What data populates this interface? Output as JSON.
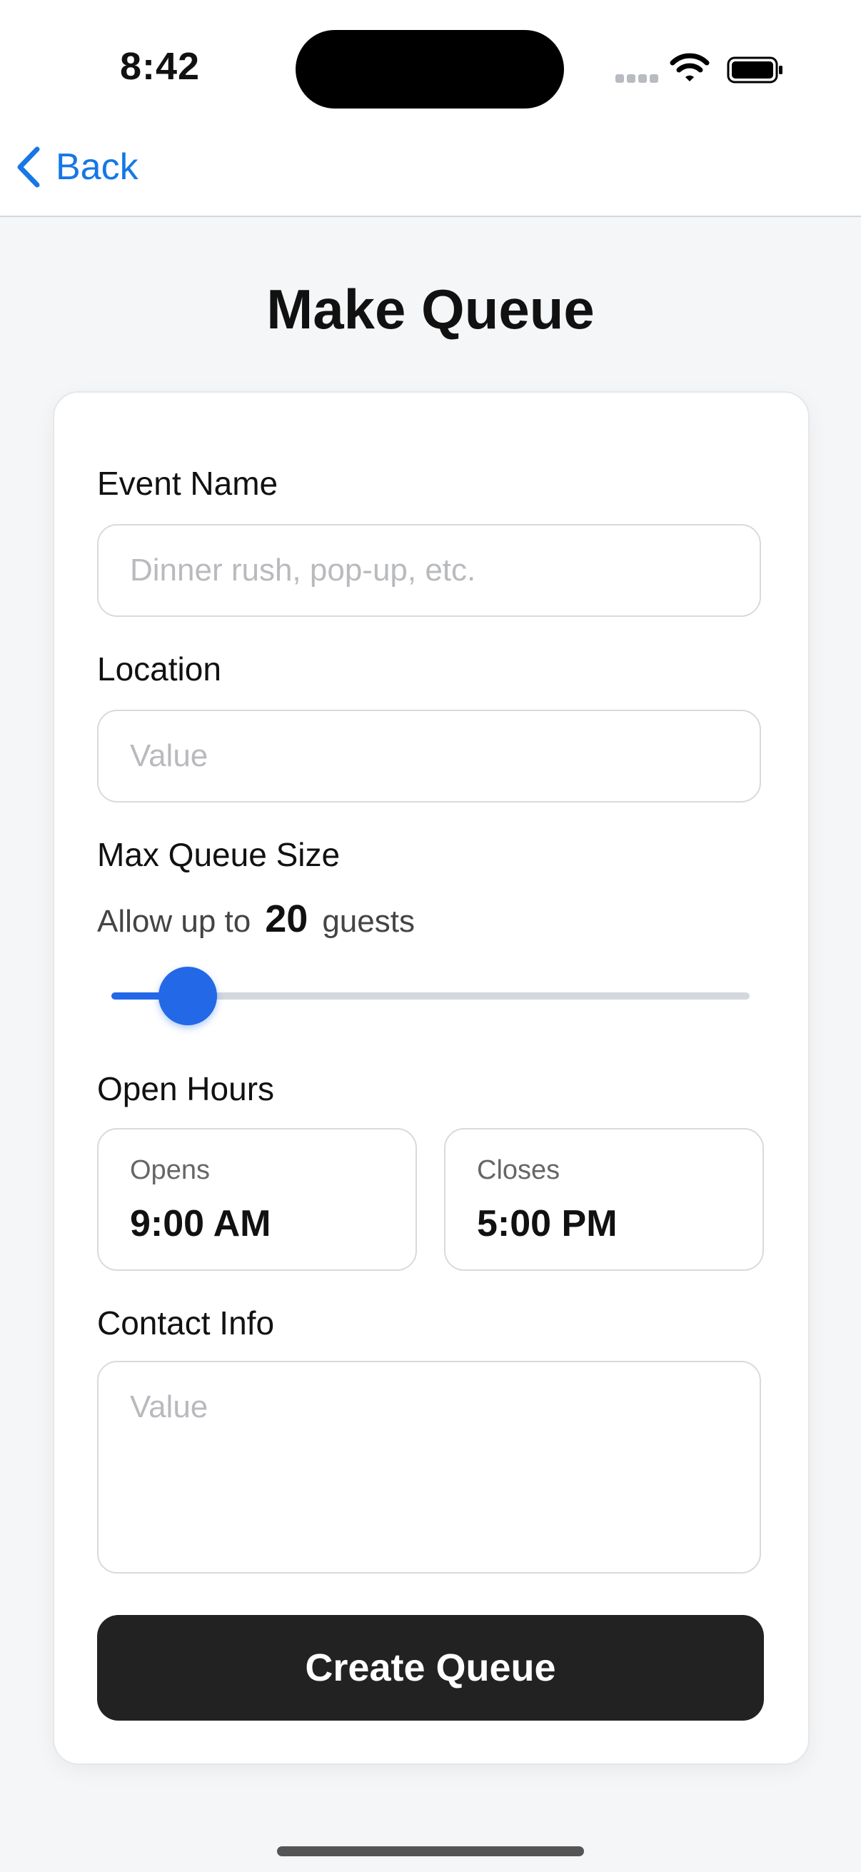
{
  "status_bar": {
    "time": "8:42"
  },
  "nav": {
    "back_label": "Back"
  },
  "page": {
    "title": "Make Queue"
  },
  "form": {
    "event_name": {
      "label": "Event Name",
      "value": "",
      "placeholder": "Dinner rush, pop-up, etc."
    },
    "location": {
      "label": "Location",
      "value": "",
      "placeholder": "Value"
    },
    "max_queue": {
      "label": "Max Queue Size",
      "prefix": "Allow up to",
      "value": "20",
      "suffix": "guests",
      "slider_fraction": 0.12
    },
    "open_hours": {
      "label": "Open Hours",
      "opens_label": "Opens",
      "opens_value": "9:00 AM",
      "closes_label": "Closes",
      "closes_value": "5:00 PM"
    },
    "contact": {
      "label": "Contact Info",
      "value": "",
      "placeholder": "Value"
    },
    "submit_label": "Create Queue"
  },
  "colors": {
    "accent": "#2368e6",
    "link": "#1677e5",
    "button": "#222222"
  }
}
